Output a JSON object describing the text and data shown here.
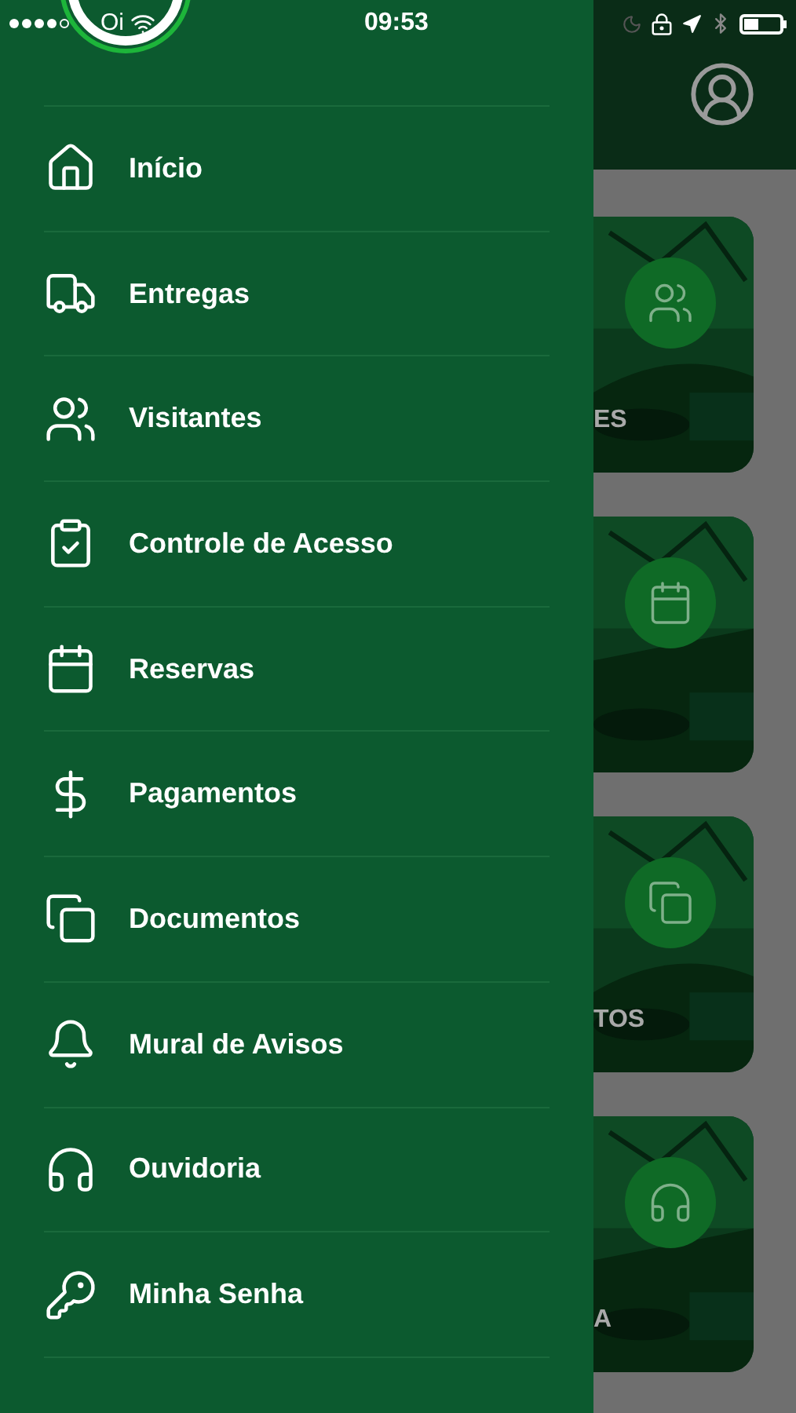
{
  "status_bar": {
    "carrier": "Oi",
    "time": "09:53"
  },
  "menu": {
    "items": [
      {
        "label": "Início"
      },
      {
        "label": "Entregas"
      },
      {
        "label": "Visitantes"
      },
      {
        "label": "Controle de Acesso"
      },
      {
        "label": "Reservas"
      },
      {
        "label": "Pagamentos"
      },
      {
        "label": "Documentos"
      },
      {
        "label": "Mural de Avisos"
      },
      {
        "label": "Ouvidoria"
      },
      {
        "label": "Minha Senha"
      }
    ]
  },
  "home": {
    "cards": [
      {
        "kind": "picture",
        "label": "ES"
      },
      {
        "kind": "picture"
      },
      {
        "kind": "picture",
        "label": "TOS"
      },
      {
        "kind": "picture",
        "label": "A"
      }
    ]
  }
}
